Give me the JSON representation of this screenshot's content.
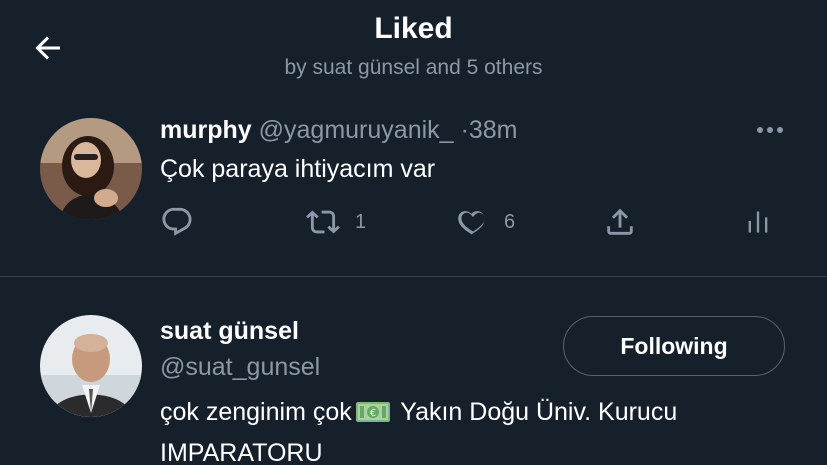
{
  "header": {
    "title": "Liked",
    "subtitle": "by suat günsel and 5 others"
  },
  "tweet": {
    "name": "murphy",
    "handle": "@yagmuruyanik_",
    "separator": "·",
    "time": "38m",
    "text": "Çok paraya ihtiyacım var",
    "actions": {
      "reply_icon": "reply-icon",
      "retweet_icon": "retweet-icon",
      "retweet_count": "1",
      "like_icon": "heart-icon",
      "like_count": "6",
      "share_icon": "share-icon",
      "analytics_icon": "analytics-icon"
    }
  },
  "user": {
    "name": "suat günsel",
    "handle": "@suat_gunsel",
    "follow_label": "Following",
    "bio_before": "çok zenginim çok",
    "bio_emoji": "money-with-wings-icon",
    "bio_after": " Yakın Doğu Üniv. Kurucu IMPARATORU"
  },
  "colors": {
    "background": "#15202b",
    "secondary_text": "#8b98a5",
    "divider": "#38444d",
    "button_border": "#536471"
  }
}
